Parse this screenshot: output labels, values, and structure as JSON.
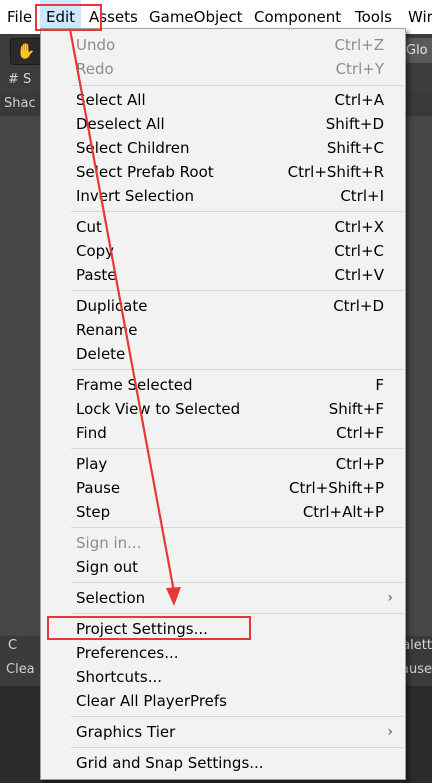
{
  "menubar": {
    "items": [
      {
        "label": "File"
      },
      {
        "label": "Edit"
      },
      {
        "label": "Assets"
      },
      {
        "label": "GameObject"
      },
      {
        "label": "Component"
      },
      {
        "label": "Tools"
      },
      {
        "label": "Wir"
      }
    ]
  },
  "toolbar": {
    "hand_icon": "hand-icon",
    "glo_label": "Glo"
  },
  "scene": {
    "tab_label": "# S",
    "sub_label": "Shac"
  },
  "console": {
    "tab_label": "C",
    "tab_right": "alett",
    "sub_label": "Clea",
    "sub_right": "ause"
  },
  "edit_menu": {
    "undo": {
      "label": "Undo",
      "shortcut": "Ctrl+Z"
    },
    "redo": {
      "label": "Redo",
      "shortcut": "Ctrl+Y"
    },
    "select_all": {
      "label": "Select All",
      "shortcut": "Ctrl+A"
    },
    "deselect_all": {
      "label": "Deselect All",
      "shortcut": "Shift+D"
    },
    "select_children": {
      "label": "Select Children",
      "shortcut": "Shift+C"
    },
    "select_prefab_root": {
      "label": "Select Prefab Root",
      "shortcut": "Ctrl+Shift+R"
    },
    "invert_selection": {
      "label": "Invert Selection",
      "shortcut": "Ctrl+I"
    },
    "cut": {
      "label": "Cut",
      "shortcut": "Ctrl+X"
    },
    "copy": {
      "label": "Copy",
      "shortcut": "Ctrl+C"
    },
    "paste": {
      "label": "Paste",
      "shortcut": "Ctrl+V"
    },
    "duplicate": {
      "label": "Duplicate",
      "shortcut": "Ctrl+D"
    },
    "rename": {
      "label": "Rename"
    },
    "delete": {
      "label": "Delete"
    },
    "frame_selected": {
      "label": "Frame Selected",
      "shortcut": "F"
    },
    "lock_view": {
      "label": "Lock View to Selected",
      "shortcut": "Shift+F"
    },
    "find": {
      "label": "Find",
      "shortcut": "Ctrl+F"
    },
    "play": {
      "label": "Play",
      "shortcut": "Ctrl+P"
    },
    "pause": {
      "label": "Pause",
      "shortcut": "Ctrl+Shift+P"
    },
    "step": {
      "label": "Step",
      "shortcut": "Ctrl+Alt+P"
    },
    "sign_in": {
      "label": "Sign in..."
    },
    "sign_out": {
      "label": "Sign out"
    },
    "selection": {
      "label": "Selection",
      "arrow": "›"
    },
    "project_settings": {
      "label": "Project Settings..."
    },
    "preferences": {
      "label": "Preferences..."
    },
    "shortcuts": {
      "label": "Shortcuts..."
    },
    "clear_playerprefs": {
      "label": "Clear All PlayerPrefs"
    },
    "graphics_tier": {
      "label": "Graphics Tier",
      "arrow": "›"
    },
    "grid_snap": {
      "label": "Grid and Snap Settings..."
    }
  },
  "colors": {
    "annotation_red": "#e53935",
    "menu_bg": "#f2f2f2",
    "menubar_active": "#cce8ff",
    "disabled_text": "#8c8c8c"
  }
}
